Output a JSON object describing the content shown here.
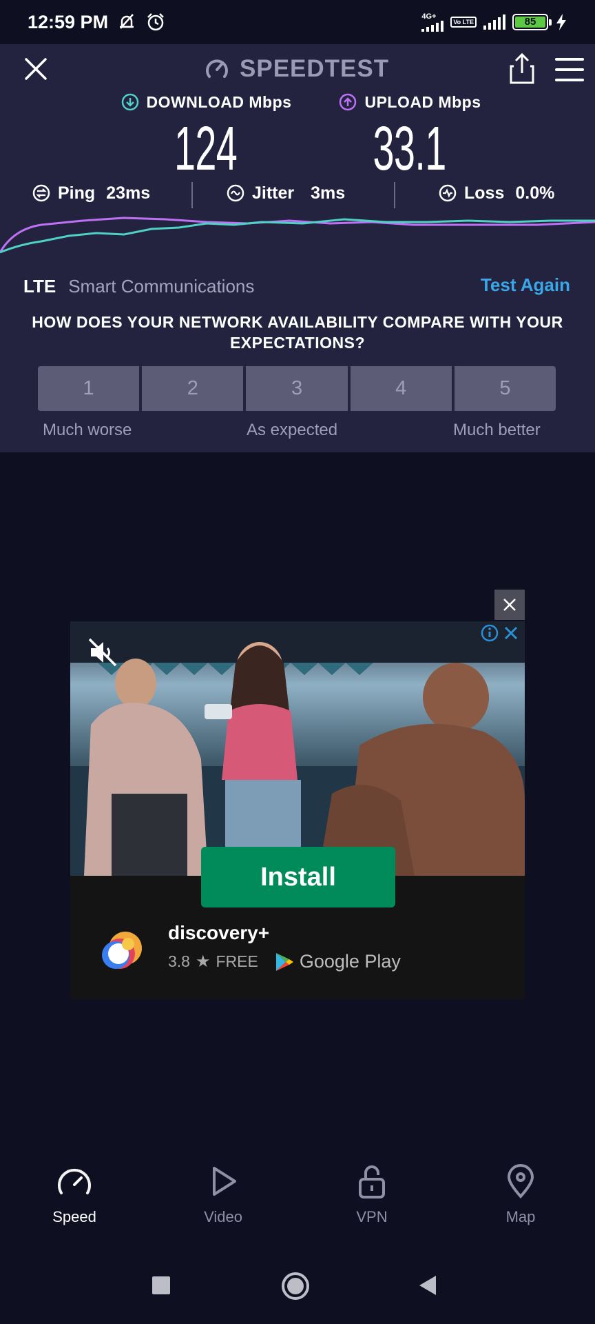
{
  "status_bar": {
    "time": "12:59 PM",
    "network": "4G+",
    "volte": "Vo LTE",
    "battery": "85"
  },
  "header": {
    "app_title": "SPEEDTEST"
  },
  "download": {
    "label": "DOWNLOAD Mbps",
    "value": "124",
    "color": "#4fd1c5"
  },
  "upload": {
    "label": "UPLOAD Mbps",
    "value": "33.1",
    "color": "#bf71f5"
  },
  "stats": {
    "ping": {
      "label": "Ping",
      "value": "23ms"
    },
    "jitter": {
      "label": "Jitter",
      "value": "3ms"
    },
    "loss": {
      "label": "Loss",
      "value": "0.0%"
    }
  },
  "connection": {
    "type": "LTE",
    "carrier": "Smart Communications",
    "test_again": "Test Again"
  },
  "survey": {
    "question": "HOW DOES YOUR NETWORK AVAILABILITY COMPARE WITH YOUR EXPECTATIONS?",
    "options": [
      "1",
      "2",
      "3",
      "4",
      "5"
    ],
    "labels": {
      "low": "Much worse",
      "mid": "As expected",
      "high": "Much better"
    }
  },
  "ad": {
    "cta": "Install",
    "app_name": "discovery+",
    "rating": "3.8",
    "price": "FREE",
    "store": "Google Play"
  },
  "bottom_nav": {
    "items": [
      {
        "label": "Speed",
        "icon": "speedometer-icon",
        "active": true
      },
      {
        "label": "Video",
        "icon": "play-icon",
        "active": false
      },
      {
        "label": "VPN",
        "icon": "lock-icon",
        "active": false
      },
      {
        "label": "Map",
        "icon": "map-pin-icon",
        "active": false
      }
    ]
  },
  "colors": {
    "accent_blue": "#3aa7e8",
    "install_green": "#018a5a",
    "panel_bg": "#232340",
    "page_bg": "#0f0f22"
  }
}
